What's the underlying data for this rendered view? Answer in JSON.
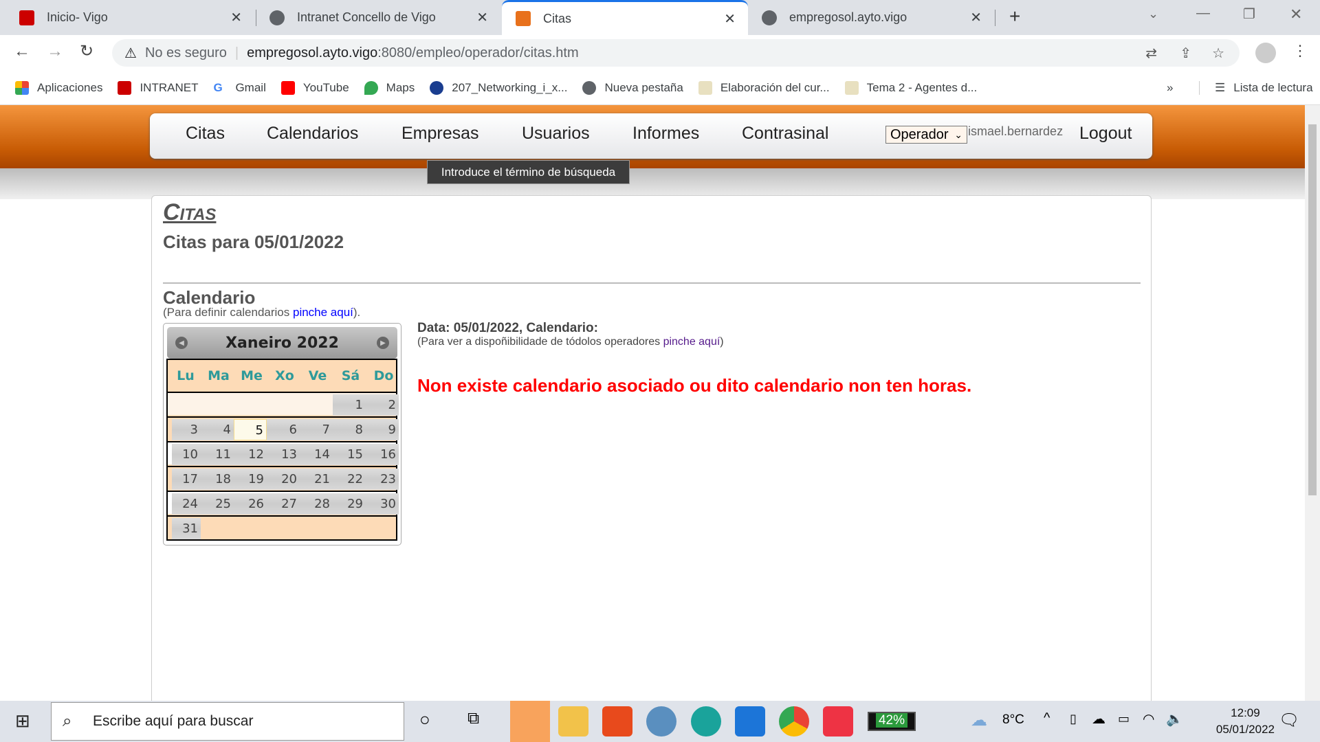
{
  "browser": {
    "tabs": [
      {
        "title": "Inicio- Vigo"
      },
      {
        "title": "Intranet Concello de Vigo"
      },
      {
        "title": "Citas",
        "active": true
      },
      {
        "title": "empregosol.ayto.vigo"
      }
    ],
    "security": "No es seguro",
    "url_host": "empregosol.ayto.vigo",
    "url_path": ":8080/empleo/operador/citas.htm",
    "bookmarks": [
      "Aplicaciones",
      "INTRANET",
      "Gmail",
      "YouTube",
      "Maps",
      "207_Networking_i_x...",
      "Nueva pestaña",
      "Elaboración del cur...",
      "Tema 2 - Agentes d..."
    ],
    "overflow": "»",
    "reading_list": "Lista de lectura"
  },
  "nav": {
    "items": [
      "Citas",
      "Calendarios",
      "Empresas",
      "Usuarios",
      "Informes",
      "Contrasinal"
    ],
    "role": "Operador",
    "user": "ismael.bernardez",
    "logout": "Logout",
    "tooltip": "Introduce el término de búsqueda"
  },
  "page": {
    "title": "Citas",
    "subtitle": "Citas para 05/01/2022",
    "cal_heading": "Calendario",
    "cal_note_pre": "(Para definir calendarios ",
    "cal_note_link": "pinche aquí",
    "cal_note_post": ").",
    "info_title": "Data: 05/01/2022, Calendario:",
    "info_note_pre": "(Para ver a dispoñibilidade de tódolos operadores ",
    "info_note_link": "pinche aquí",
    "info_note_post": ")",
    "error": "Non existe calendario asociado ou dito calendario non ten horas."
  },
  "calendar": {
    "month": "Xaneiro 2022",
    "weekdays": [
      "Lu",
      "Ma",
      "Me",
      "Xo",
      "Ve",
      "Sá",
      "Do"
    ],
    "weeks": [
      [
        "",
        "",
        "",
        "",
        "",
        "1",
        "2"
      ],
      [
        "3",
        "4",
        "5",
        "6",
        "7",
        "8",
        "9"
      ],
      [
        "10",
        "11",
        "12",
        "13",
        "14",
        "15",
        "16"
      ],
      [
        "17",
        "18",
        "19",
        "20",
        "21",
        "22",
        "23"
      ],
      [
        "24",
        "25",
        "26",
        "27",
        "28",
        "29",
        "30"
      ],
      [
        "31",
        "",
        "",
        "",
        "",
        "",
        ""
      ]
    ],
    "selected": "5"
  },
  "taskbar": {
    "search_placeholder": "Escribe aquí para buscar",
    "battery": "42%",
    "weather": "8°C",
    "time": "12:09",
    "date": "05/01/2022"
  }
}
